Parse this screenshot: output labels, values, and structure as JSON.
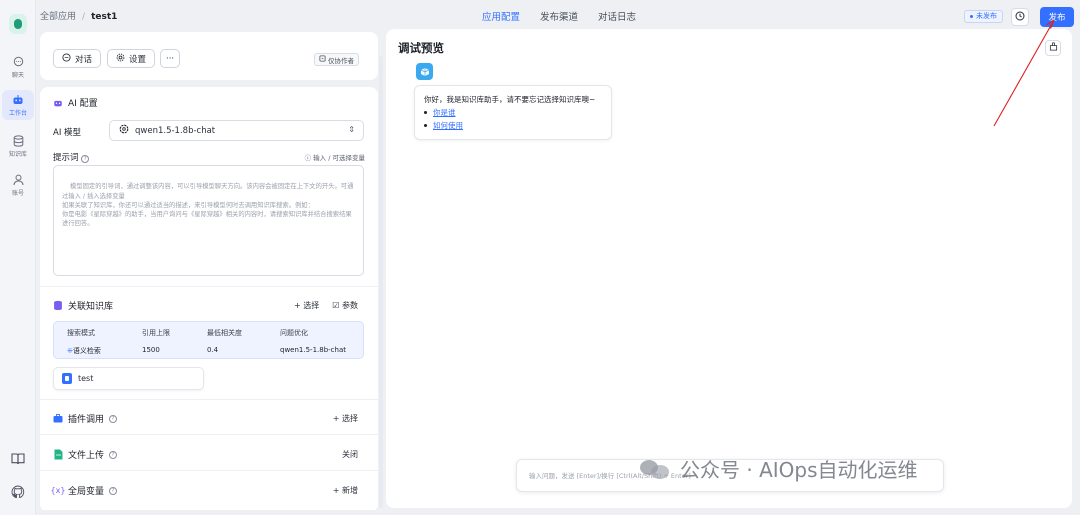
{
  "rail": {
    "items": [
      {
        "label": "聊天",
        "icon": "chat-icon"
      },
      {
        "label": "工作台",
        "icon": "robot-icon"
      },
      {
        "label": "知识库",
        "icon": "database-icon"
      },
      {
        "label": "账号",
        "icon": "user-icon"
      }
    ],
    "bottom_icons": [
      "book-icon",
      "github-icon"
    ]
  },
  "header": {
    "breadcrumb_root": "全部应用",
    "breadcrumb_sep": "/",
    "breadcrumb_current": "test1",
    "tabs": [
      "应用配置",
      "发布渠道",
      "对话日志"
    ],
    "active_tab": "应用配置",
    "status_badge": "未发布",
    "publish_label": "发布"
  },
  "toolbar": {
    "chat_label": "对话",
    "settings_label": "设置",
    "more_label": "···",
    "author_only_label": "仅协作者"
  },
  "ai_config": {
    "title": "AI 配置",
    "model_label": "AI 模型",
    "model_value": "qwen1.5-1.8b-chat",
    "prompt_label": "提示词",
    "prompt_hint": "输入 / 可选择变量",
    "prompt_placeholder": "模型固定的引导词，通过调整该内容，可以引导模型聊天方向。该内容会被固定在上下文的开头。可通过输入 / 插入选择变量\n如果关联了知识库，你还可以通过适当的描述，来引导模型何时去调用知识库搜索。例如：\n你是电影《星际穿越》的助手，当用户询问与《星际穿越》相关的内容时，请搜索知识库并结合搜索结果进行回答。"
  },
  "knowledge": {
    "title": "关联知识库",
    "select_label": "选择",
    "params_label": "参数",
    "table": {
      "headers": [
        "搜索模式",
        "引用上限",
        "最低相关度",
        "问题优化"
      ],
      "values": [
        "语义检索",
        "1500",
        "0.4",
        "qwen1.5-1.8b-chat"
      ]
    },
    "datasets": [
      "test"
    ]
  },
  "plugins": {
    "title": "插件调用",
    "action": "选择"
  },
  "file_upload": {
    "title": "文件上传",
    "action": "关闭"
  },
  "variables": {
    "title": "全局变量",
    "action": "新增"
  },
  "preview": {
    "title": "调试预览",
    "greeting": "你好，我是知识库助手，请不要忘记选择知识库噢~",
    "quick_questions": [
      "你是谁",
      "如何使用"
    ],
    "input_placeholder": "输入问题，发送 [Enter]/换行 [Ctrl(Alt/Shift) + Enter]"
  },
  "watermark": {
    "text": "公众号 · AIOps自动化运维"
  },
  "colors": {
    "accent": "#3370ff",
    "annotation": "#e02020",
    "background": "#eef0f4"
  }
}
